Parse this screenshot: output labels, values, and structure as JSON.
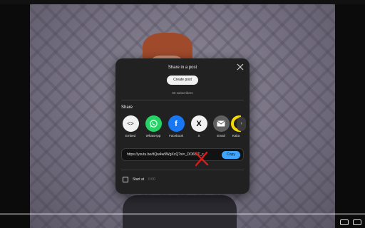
{
  "dialog": {
    "title": "Share in a post",
    "create_post_label": "Create post",
    "subscribers_text": "60 subscribers",
    "share_heading": "Share",
    "share_options": [
      {
        "label": "Embed",
        "icon": "embed-icon"
      },
      {
        "label": "WhatsApp",
        "icon": "whatsapp-icon"
      },
      {
        "label": "Facebook",
        "icon": "facebook-icon"
      },
      {
        "label": "X",
        "icon": "x-icon"
      },
      {
        "label": "Email",
        "icon": "email-icon"
      },
      {
        "label": "Kaka",
        "icon": "kakaotalk-icon"
      }
    ],
    "url": "https://youtu.be/dQw4w9WgXcQ?si=_DO6BIT_c",
    "copy_label": "Copy",
    "start_at_label": "Start at",
    "start_at_time": "0:00"
  },
  "colors": {
    "dialog_bg": "#212121",
    "copy_accent": "#3ea6ff",
    "red_annotation": "#e01818"
  }
}
